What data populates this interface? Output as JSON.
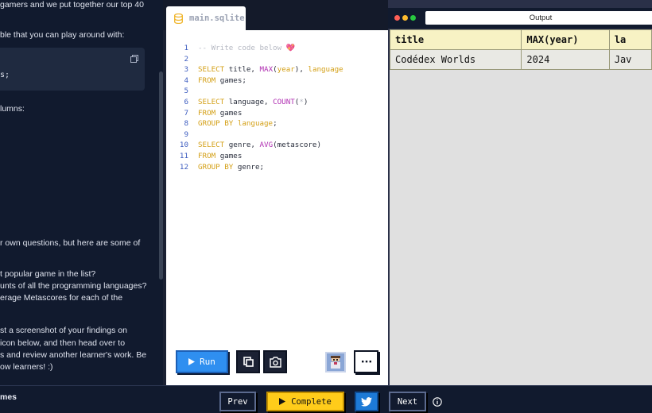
{
  "instructions": {
    "lines": [
      "gamers and we put together our top 40",
      "ble that you can play around with:",
      "lumns:",
      "r own questions, but here are some of",
      "t popular game in the list?",
      "unts of all the programming languages?",
      "erage Metascores for each of the",
      "st a screenshot of your findings on",
      "icon below, and then head over to",
      "s and review another learner's work. Be",
      "ow learners! :)"
    ],
    "snippet_text": "s;",
    "course_label": "mes"
  },
  "editor": {
    "file_name": "main.sqlite",
    "line_numbers": [
      "1",
      "2",
      "3",
      "4",
      "5",
      "6",
      "7",
      "8",
      "9",
      "10",
      "11",
      "12"
    ],
    "code": {
      "comment": "-- Write code below",
      "heart": "💖",
      "select_kw": "SELECT",
      "from_kw": "FROM",
      "group_by_kw": "GROUP BY",
      "l3_title": "title,",
      "l3_max": "MAX",
      "l3_year": "year",
      "l3_language": "language",
      "games_tbl": "games;",
      "games_plain": "games",
      "l6_language": "language,",
      "l6_count": "COUNT",
      "l6_star": "*",
      "l8_language": "language",
      "l10_genre": "genre,",
      "l10_avg": "AVG",
      "l10_metascore": "metascore",
      "l12_genre": "genre;",
      "open_paren": "(",
      "close_paren": ")",
      "close_paren_comma": "),",
      "semicolon": ";"
    },
    "run_label": "Run"
  },
  "output": {
    "title": "Output",
    "columns": [
      "title",
      "MAX(year)",
      "la"
    ],
    "rows": [
      [
        "Codédex Worlds",
        "2024",
        "Jav"
      ]
    ]
  },
  "bottom": {
    "prev_label": "Prev",
    "complete_label": "Complete",
    "next_label": "Next"
  },
  "colors": {
    "run_button": "#2f8ff0",
    "complete_button": "#ffcc1a",
    "twitter_button": "#1d7ad6",
    "table_header": "#f7f2c4",
    "dot_red": "#ff5f57",
    "dot_yellow": "#febc2e",
    "dot_green": "#28c840"
  }
}
